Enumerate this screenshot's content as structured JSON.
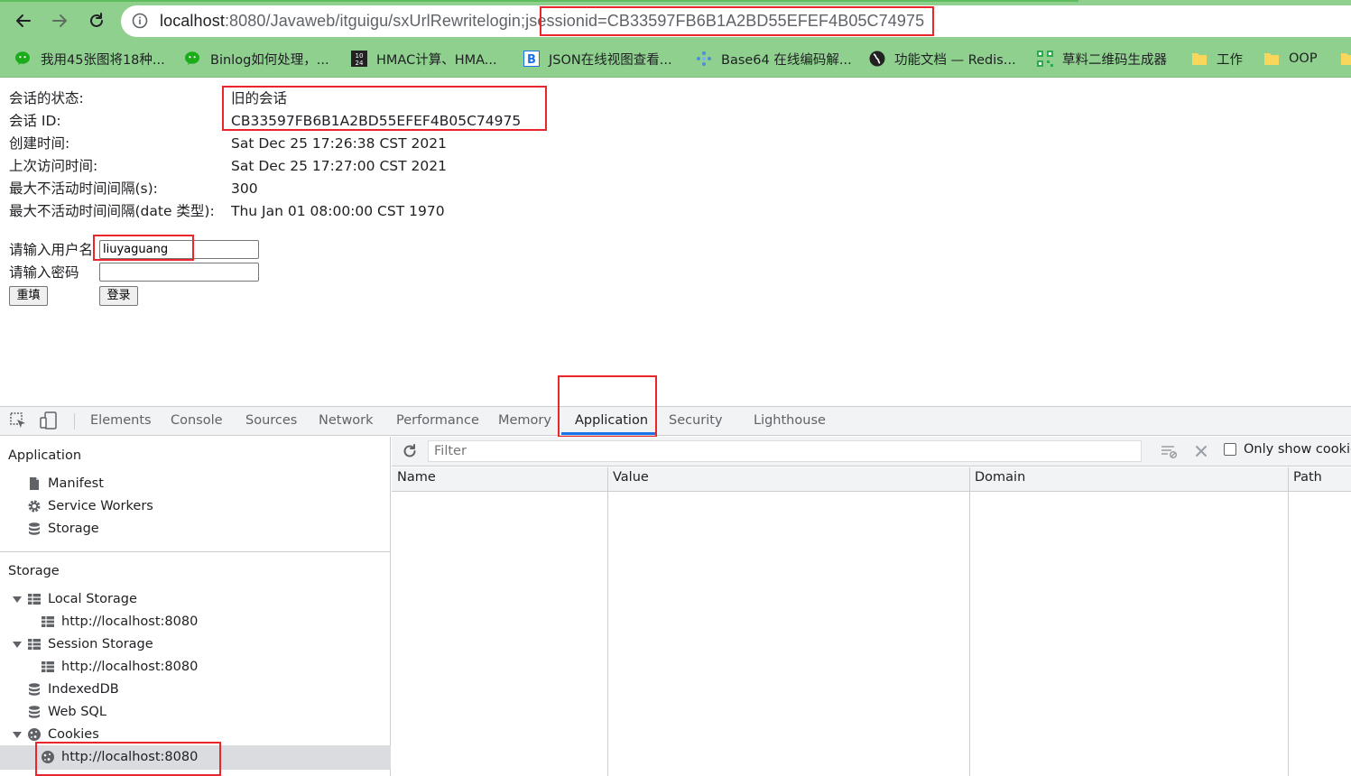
{
  "browser": {
    "url_host": "localhost",
    "url_rest": ":8080/Javaweb/itguigu/sxUrlRewritelogin",
    "url_session": ";jsessionid=CB33597FB6B1A2BD55EFEF4B05C74975",
    "bookmarks": [
      {
        "label": "我用45张图将18种...",
        "icon": "wechat-icon",
        "color": "#1aad19"
      },
      {
        "label": "Binlog如何处理，...",
        "icon": "wechat-icon",
        "color": "#1aad19"
      },
      {
        "label": "HMAC计算、HMA...",
        "icon": "calendar-icon",
        "color": "#222222"
      },
      {
        "label": "JSON在线视图查看...",
        "icon": "bejson-icon",
        "color": "#1a73e8"
      },
      {
        "label": "Base64 在线编码解...",
        "icon": "dots-icon",
        "color": "#4a90d9"
      },
      {
        "label": "功能文档 — Redis...",
        "icon": "globe-icon",
        "color": "#222222"
      },
      {
        "label": "草料二维码生成器",
        "icon": "qrcode-icon",
        "color": "#2fa84f"
      },
      {
        "label": "工作",
        "icon": "folder-icon",
        "color": "#f9d65c"
      },
      {
        "label": "OOP",
        "icon": "folder-icon",
        "color": "#f9d65c"
      }
    ]
  },
  "session_info": {
    "rows": [
      {
        "label": "会话的状态:",
        "value": "旧的会话"
      },
      {
        "label": "会话 ID:",
        "value": "CB33597FB6B1A2BD55EFEF4B05C74975"
      },
      {
        "label": "创建时间:",
        "value": "Sat Dec 25 17:26:38 CST 2021"
      },
      {
        "label": "上次访问时间:",
        "value": "Sat Dec 25 17:27:00 CST 2021"
      },
      {
        "label": "最大不活动时间间隔(s):",
        "value": "300"
      },
      {
        "label": "最大不活动时间间隔(date 类型):",
        "value": "Thu Jan 01 08:00:00 CST 1970"
      }
    ]
  },
  "login_form": {
    "username_label": "请输入用户名",
    "username_value": "liuyaguang",
    "password_label": "请输入密码",
    "password_value": "",
    "reset_label": "重填",
    "submit_label": "登录"
  },
  "devtools": {
    "tabs": [
      "Elements",
      "Console",
      "Sources",
      "Network",
      "Performance",
      "Memory",
      "Application",
      "Security",
      "Lighthouse"
    ],
    "active_tab": "Application",
    "sidebar": {
      "application_heading": "Application",
      "application_items": [
        "Manifest",
        "Service Workers",
        "Storage"
      ],
      "storage_heading": "Storage",
      "local_storage": "Local Storage",
      "local_storage_child": "http://localhost:8080",
      "session_storage": "Session Storage",
      "session_storage_child": "http://localhost:8080",
      "indexeddb": "IndexedDB",
      "websql": "Web SQL",
      "cookies": "Cookies",
      "cookies_child": "http://localhost:8080"
    },
    "cookies_panel": {
      "filter_placeholder": "Filter",
      "only_show_label": "Only show cookie",
      "columns": [
        "Name",
        "Value",
        "Domain",
        "Path"
      ]
    }
  },
  "colors": {
    "toolbar_bg": "#8fd08f",
    "highlight_box": "#e8262b",
    "active_tab_underline": "#1a73e8"
  }
}
